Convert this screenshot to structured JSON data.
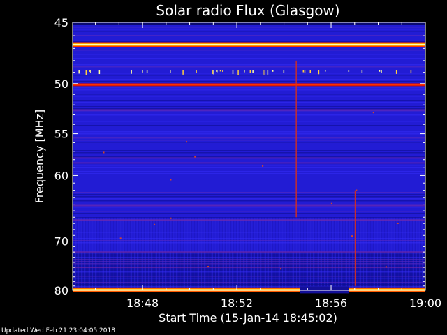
{
  "updated_text": "Updated Wed Feb 21 23:04:05 2018",
  "chart_data": {
    "type": "heatmap",
    "title": "Solar radio Flux (Glasgow)",
    "xlabel": "Start Time (15-Jan-14 18:45:02)",
    "ylabel": "Frequency [MHz]",
    "x_ticks": [
      "18:48",
      "18:52",
      "18:56",
      "19:00"
    ],
    "x_range": [
      "18:45:02",
      "19:00:00"
    ],
    "y_ticks": [
      45,
      50,
      55,
      60,
      70,
      80
    ],
    "y_range": [
      45,
      80
    ],
    "y_scale": "reciprocal",
    "colormap": [
      "#000080",
      "#0000ff",
      "#ff0000",
      "#ffff00",
      "#ffffff"
    ],
    "bands": [
      {
        "frequency": 46.7,
        "level": "high"
      },
      {
        "frequency": 50.1,
        "level": "medium"
      },
      {
        "frequency": 79.9,
        "level": "high"
      }
    ],
    "bursts": [
      {
        "time": "18:54:30",
        "f_start": 48,
        "f_end": 66
      },
      {
        "time": "18:57:00",
        "f_start": 62,
        "f_end": 79
      }
    ],
    "gaps": [
      {
        "frequency": 79.9,
        "start": "18:54:40",
        "end": "18:56:45"
      }
    ]
  }
}
